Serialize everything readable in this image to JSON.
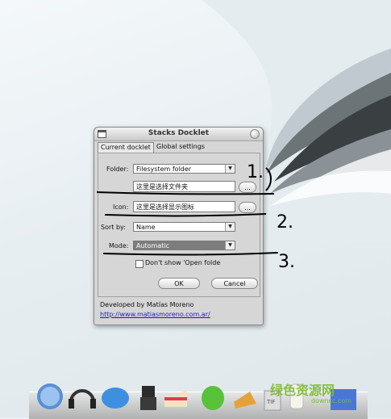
{
  "dialog": {
    "title": "Stacks Docklet",
    "tabs": [
      "Current docklet",
      "Global settings"
    ],
    "folder_label": "Folder:",
    "folder_value": "Filesystem folder",
    "folder_path": "这里是选择文件夹",
    "browse_label": "...",
    "icon_label": "Icon:",
    "icon_path": "这里是选择显示图标",
    "sortby_label": "Sort by:",
    "sortby_value": "Name",
    "mode_label": "Mode:",
    "mode_value": "Automatic",
    "dont_show_label": "Don't show 'Open folde",
    "ok_label": "OK",
    "cancel_label": "Cancel",
    "developed_by": "Developed by Matías Moreno",
    "url": "http://www.matiasmoreno.com.ar/"
  },
  "annotations": [
    "1.",
    "2.",
    "3."
  ],
  "watermark": {
    "text": "绿色资源网",
    "sub": "downcc.com"
  },
  "dock_icons": [
    "hi-bubble-icon",
    "headphones-icon",
    "twitter-bird-icon",
    "robot-icon",
    "cake-icon",
    "green-bag-icon",
    "sneaker-icon",
    "tif-file-icon",
    "milk-bottle-icon",
    "blue-bucket-icon"
  ]
}
